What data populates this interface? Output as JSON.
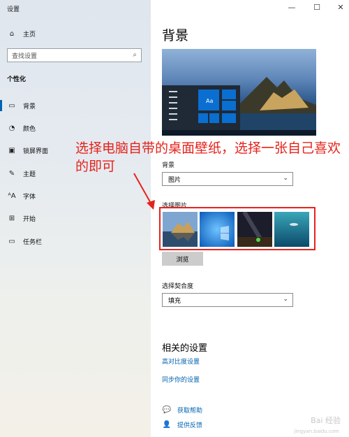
{
  "window": {
    "title": "设置",
    "controls": {
      "minimize": "—",
      "maximize": "☐",
      "close": "✕"
    }
  },
  "sidebar": {
    "home": "主页",
    "search_placeholder": "查找设置",
    "section": "个性化",
    "items": [
      {
        "label": "背景",
        "icon": "picture-icon"
      },
      {
        "label": "颜色",
        "icon": "palette-icon"
      },
      {
        "label": "锁屏界面",
        "icon": "lock-screen-icon"
      },
      {
        "label": "主题",
        "icon": "theme-icon"
      },
      {
        "label": "字体",
        "icon": "font-icon"
      },
      {
        "label": "开始",
        "icon": "start-icon"
      },
      {
        "label": "任务栏",
        "icon": "taskbar-icon"
      }
    ]
  },
  "main": {
    "title": "背景",
    "background_label": "背景",
    "background_value": "图片",
    "choose_picture_label": "选择图片",
    "browse": "浏览",
    "fit_label": "选择契合度",
    "fit_value": "填充",
    "related_title": "相关的设置",
    "related_links": [
      "高对比度设置",
      "同步你的设置"
    ],
    "help": "获取帮助",
    "feedback": "提供反馈",
    "preview_tile_text": "Aa"
  },
  "annotation": {
    "text": "选择电脑自带的桌面壁纸，选择一张自己喜欢的即可",
    "color": "#e5231c"
  },
  "watermark": {
    "text": "Bai 经验",
    "sub": "jingyan.baidu.com"
  },
  "colors": {
    "accent": "#0063b1",
    "annotation": "#e5231c",
    "tile": "#0a6fd0"
  }
}
